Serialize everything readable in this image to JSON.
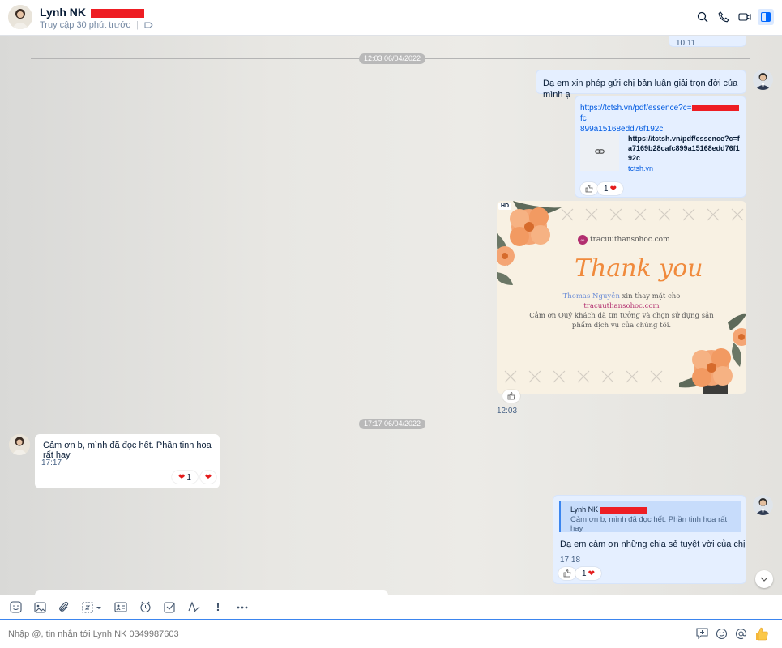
{
  "header": {
    "contact_name": "Lynh NK",
    "status": "Truy cập 30 phút trước"
  },
  "messages": {
    "top_time": "10:11",
    "divider1": "12:03 06/04/2022",
    "msg1": "Dạ em xin phép gửi chị bản luận giải trọn đời của mình ạ",
    "link_line1_start": "https://tctsh.vn/pdf/essence?c=",
    "link_line1_end": "fc",
    "link_line2": "899a15168edd76f192c",
    "preview_url": "https://tctsh.vn/pdf/essence?c=fa7169b28cafc899a15168edd76f192c",
    "preview_domain": "tctsh.vn",
    "link_react_count": "1",
    "image_badge": "HD",
    "image_time": "12:03",
    "card": {
      "site": "tracuuthansohoc.com",
      "thank": "Thank you",
      "line1_name": "Thomas Nguyễn",
      "line1_rest": "xin thay mặt cho",
      "line2": "tracuuthansohoc.com",
      "line3": "Cảm ơn Quý khách đã tin tưởng và chọn sử dụng sản",
      "line4": "phẩm dịch vụ của chúng tôi."
    },
    "divider2": "17:17 06/04/2022",
    "msg2": "Cảm ơn b, mình đã đọc hết. Phần tinh hoa rất hay",
    "msg2_time": "17:17",
    "msg2_react_count": "1",
    "quote_name": "Lynh NK",
    "quote_text": "Cảm ơn b, mình đã đọc hết. Phần tinh hoa rất hay",
    "msg3": "Dạ em cảm ơn những chia sẻ tuyệt vời của chị",
    "msg3_time": "17:18",
    "msg3_react_count": "1"
  },
  "composer": {
    "placeholder": "Nhập @, tin nhắn tới Lynh NK 0349987603"
  },
  "colors": {
    "accent": "#0068ff",
    "redaction": "#ee1d23",
    "my_bubble": "#e5efff",
    "card_orange": "#f08a3c"
  },
  "icons": [
    "search-icon",
    "phone-icon",
    "video-icon",
    "sidebar-toggle-icon",
    "sticker-icon",
    "image-icon",
    "attachment-icon",
    "screenshot-icon",
    "contact-card-icon",
    "reminder-icon",
    "todo-icon",
    "text-format-icon",
    "urgent-icon",
    "more-icon",
    "quick-message-icon",
    "emoji-icon",
    "mention-icon",
    "thumbs-up-icon",
    "like-icon",
    "heart-icon",
    "link-icon",
    "scroll-down-icon"
  ]
}
